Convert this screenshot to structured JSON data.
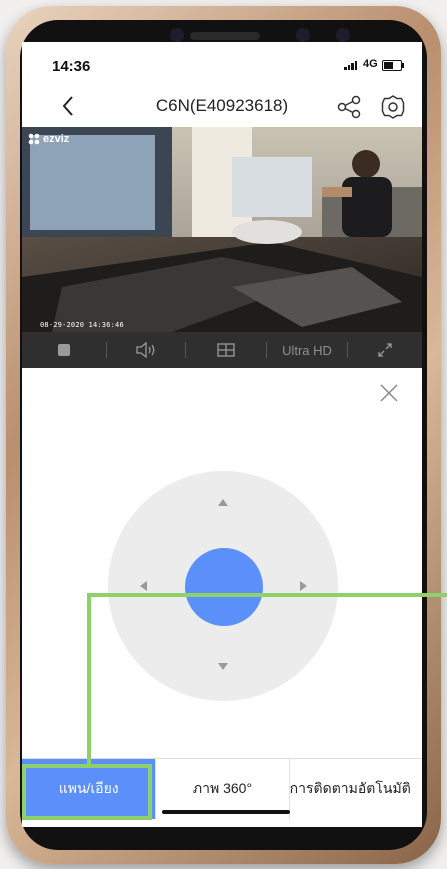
{
  "status_bar": {
    "time": "14:36",
    "network": "4G"
  },
  "nav": {
    "title": "C6N(E40923618)"
  },
  "video": {
    "brand": "ezviz",
    "timestamp": "08-29-2020 14:36:46"
  },
  "toolbar": {
    "quality_label": "Ultra HD"
  },
  "tabs": [
    {
      "label": "แพน/เอียง",
      "active": true
    },
    {
      "label": "ภาพ 360°",
      "active": false
    },
    {
      "label": "การติดตามอัตโนมัติ",
      "active": false
    }
  ],
  "colors": {
    "accent": "#5b8ff9",
    "highlight": "#8ed16a",
    "toolbar": "#2f2f2f"
  },
  "icons": [
    "back-icon",
    "share-icon",
    "settings-icon",
    "stop-icon",
    "speaker-icon",
    "split-screen-icon",
    "fullscreen-icon",
    "close-icon"
  ]
}
